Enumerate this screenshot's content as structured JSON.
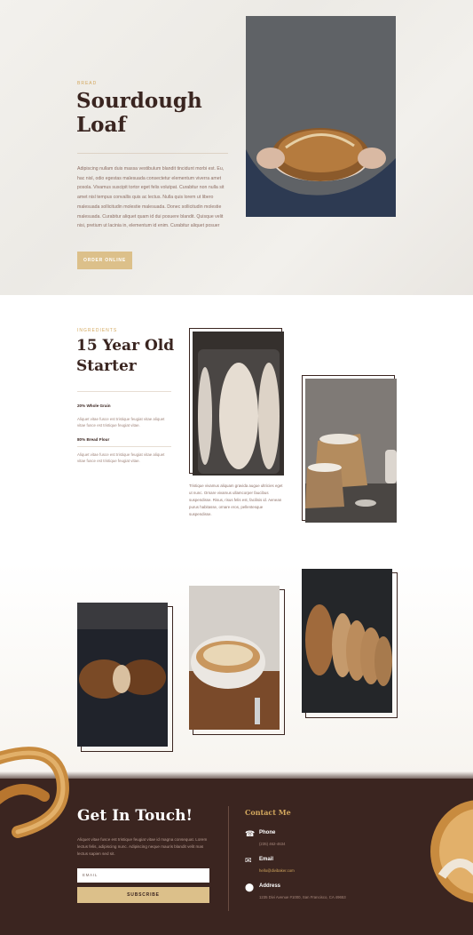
{
  "hero": {
    "eyebrow": "BREAD",
    "title_line1": "Sourdough",
    "title_line2": "Loaf",
    "body": "Adipiscing nullam duis massa vestibulum blandit tincidunt morbi est. Eu, hac nisl, odio egestas malesuada consectetur elementum viverra amet posola. Vivamus suscipit tortor eget felis volutpat. Curabitur non nulla sit amet nisl tempus convallis quis ac lectus. Nulla quis lorem ut libero malesuada sollicitudin molestie malesuada. Donec sollicitudin molestie malesuada. Curabitur aliquet quam id dui posuere blandit. Quisque velit nisi, pretium ut lacinia in, elementum id enim. Curabitur aliquet posuer",
    "button": "ORDER ONLINE"
  },
  "ingredients": {
    "eyebrow": "INGREDIENTS",
    "title_line1": "15 Year Old",
    "title_line2": "Starter",
    "items": [
      {
        "label": "20% Whole Grain",
        "text": "Aliquet vitae fusce est tristique feugiat vitae aliquet vitae fusce est tristique feugiat vitae."
      },
      {
        "label": "80% Bread Flour",
        "text": "Aliquet vitae fusce est tristique feugiat vitae aliquet vitae fusce est tristique feugiat vitae."
      }
    ],
    "caption": "Tristique vivamus aliquam gravida augue ultricies eget ut nunc. Ornare vivamus ullamcorper faucibus suspendisse. Risus, risus felis est, facilisis id. Aenean purus habitasse, ornare eros, pellentesque suspendisse."
  },
  "footer": {
    "title": "Get In Touch!",
    "body": "Aliquet vitae fusce est tristique feugiat vitae id magna consequat. Lorem lectus felis, adipiscing nunc. Adipiscing neque mauris blandit velit mas lectus sapien sed sit.",
    "email_placeholder": "EMAIL",
    "subscribe": "SUBSCRIBE",
    "contact_title": "Contact Me",
    "phone_label": "Phone",
    "phone_value": "(235) 462-4634",
    "email_label": "Email",
    "email_value": "hello@divibaker.com",
    "address_label": "Address",
    "address_value": "1235 Divi Avenue #1000, San Francisco, CA 49653"
  },
  "icons": {
    "phone": "phone-icon",
    "email": "envelope-icon",
    "address": "map-pin-icon"
  },
  "colors": {
    "accent_gold": "#d3a85e",
    "button_gold": "#dcc08a",
    "dark_brown": "#3b2520",
    "text_brown": "#8c6d63"
  }
}
